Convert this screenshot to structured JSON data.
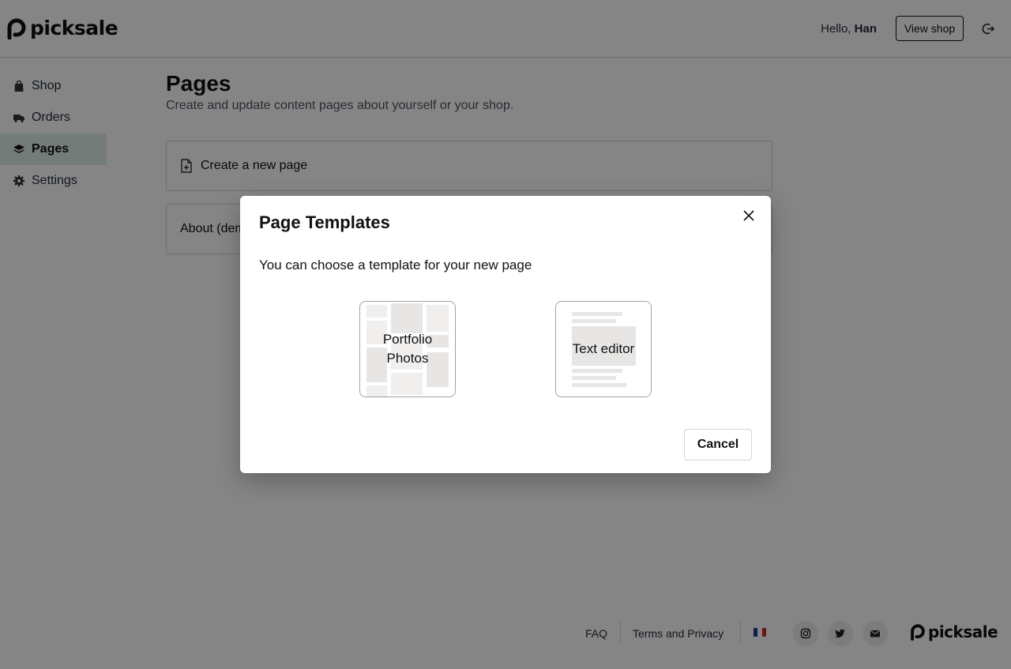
{
  "brand": {
    "name": "picksale"
  },
  "header": {
    "greeting": "Hello,",
    "user_name": "Han",
    "view_shop_label": "View shop"
  },
  "sidebar": {
    "items": [
      {
        "label": "Shop",
        "icon": "shopping-bag-icon"
      },
      {
        "label": "Orders",
        "icon": "truck-icon"
      },
      {
        "label": "Pages",
        "icon": "layers-icon",
        "active": true
      },
      {
        "label": "Settings",
        "icon": "gear-icon"
      }
    ]
  },
  "main": {
    "title": "Pages",
    "subtitle": "Create and update content pages about yourself or your shop.",
    "create_page_label": "Create a new page",
    "pages": [
      {
        "label": "About (demo)"
      }
    ]
  },
  "modal": {
    "title": "Page Templates",
    "description": "You can choose a template for your new page",
    "templates": [
      {
        "label": "Portfolio\nPhotos"
      },
      {
        "label": "Text editor"
      }
    ],
    "cancel_label": "Cancel"
  },
  "footer": {
    "faq": "FAQ",
    "terms": "Terms and Privacy",
    "language_flag": "french-flag-icon",
    "social": [
      "instagram-icon",
      "twitter-icon",
      "mail-icon"
    ]
  },
  "colors": {
    "overlay": "rgba(0,0,0,0.48)",
    "active_nav_bg": "#dfeee9",
    "text": "#1f2937"
  }
}
